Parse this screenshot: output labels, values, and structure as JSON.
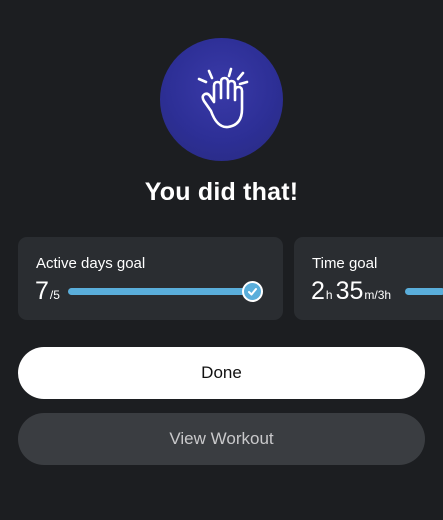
{
  "celebration": {
    "icon": "high-five-hand-icon",
    "title": "You did that!"
  },
  "goals": {
    "active_days": {
      "label": "Active days goal",
      "value": "7",
      "target": "/5",
      "progress": 1.0,
      "completed": true
    },
    "time": {
      "label": "Time goal",
      "hours": "2",
      "hours_unit": "h",
      "minutes": "35",
      "minutes_unit": "m/3h"
    }
  },
  "actions": {
    "done_label": "Done",
    "view_workout_label": "View Workout"
  },
  "colors": {
    "background": "#1c1e21",
    "card": "#2a2d31",
    "accent": "#5aaedb",
    "badge": "#2d2f96"
  }
}
